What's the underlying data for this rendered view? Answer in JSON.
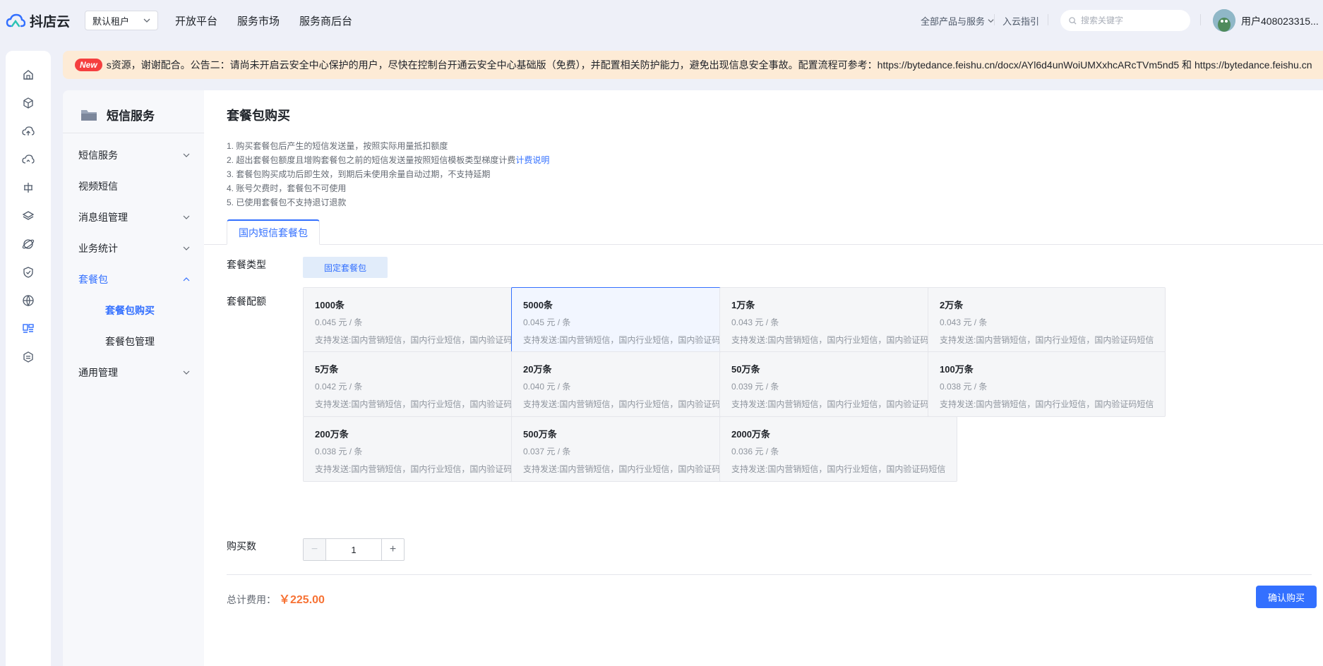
{
  "header": {
    "logo_text": "抖店云",
    "tenant": "默认租户",
    "nav": [
      "开放平台",
      "服务市场",
      "服务商后台"
    ],
    "all_products": "全部产品与服务",
    "guide": "入云指引",
    "search_placeholder": "搜索关键字",
    "user": "用户408023315..."
  },
  "notice": {
    "badge": "New",
    "text": "s资源，谢谢配合。公告二：请尚未开启云安全中心保护的用户，尽快在控制台开通云安全中心基础版（免费），并配置相关防护能力，避免出现信息安全事故。配置流程可参考：https://bytedance.feishu.cn/docx/AYl6d4unWoiUMXxhcARcTVm5nd5 和 https://bytedance.feishu.cn"
  },
  "sidebar": {
    "title": "短信服务",
    "items": [
      {
        "label": "短信服务"
      },
      {
        "label": "视频短信"
      },
      {
        "label": "消息组管理"
      },
      {
        "label": "业务统计"
      },
      {
        "label": "套餐包"
      },
      {
        "label": "通用管理"
      }
    ],
    "sub_items": [
      {
        "label": "套餐包购买"
      },
      {
        "label": "套餐包管理"
      }
    ]
  },
  "main": {
    "title": "套餐包购买",
    "notes": [
      "1. 购买套餐包后产生的短信发送量，按照实际用量抵扣额度",
      "2. 超出套餐包额度且增购套餐包之前的短信发送量按照短信模板类型梯度计费",
      "3. 套餐包购买成功后即生效，到期后未使用余量自动过期，不支持延期",
      "4. 账号欠费时，套餐包不可使用",
      "5. 已使用套餐包不支持退订退款"
    ],
    "billing_link": "计费说明",
    "tab": "国内短信套餐包",
    "type_label": "套餐类型",
    "type_value": "固定套餐包",
    "quota_label": "套餐配额",
    "packages": [
      {
        "name": "1000条",
        "price": "0.045 元 / 条",
        "selected": false
      },
      {
        "name": "5000条",
        "price": "0.045 元 / 条",
        "selected": true
      },
      {
        "name": "1万条",
        "price": "0.043 元 / 条",
        "selected": false
      },
      {
        "name": "2万条",
        "price": "0.043 元 / 条",
        "selected": false
      },
      {
        "name": "5万条",
        "price": "0.042 元 / 条",
        "selected": false
      },
      {
        "name": "20万条",
        "price": "0.040 元 / 条",
        "selected": false
      },
      {
        "name": "50万条",
        "price": "0.039 元 / 条",
        "selected": false
      },
      {
        "name": "100万条",
        "price": "0.038 元 / 条",
        "selected": false
      },
      {
        "name": "200万条",
        "price": "0.038 元 / 条",
        "selected": false
      },
      {
        "name": "500万条",
        "price": "0.037 元 / 条",
        "selected": false
      },
      {
        "name": "2000万条",
        "price": "0.036 元 / 条",
        "selected": false
      }
    ],
    "package_desc": "支持发送:国内营销短信，国内行业短信，国内验证码短信",
    "qty_label": "购买数",
    "qty": "1",
    "total_label": "总计费用：",
    "total": "￥225.00",
    "confirm": "确认购买"
  },
  "colors": {
    "accent": "#3370ff",
    "price": "#f77234",
    "notice_bg": "#fdebd6",
    "badge": "#f53f3f"
  }
}
